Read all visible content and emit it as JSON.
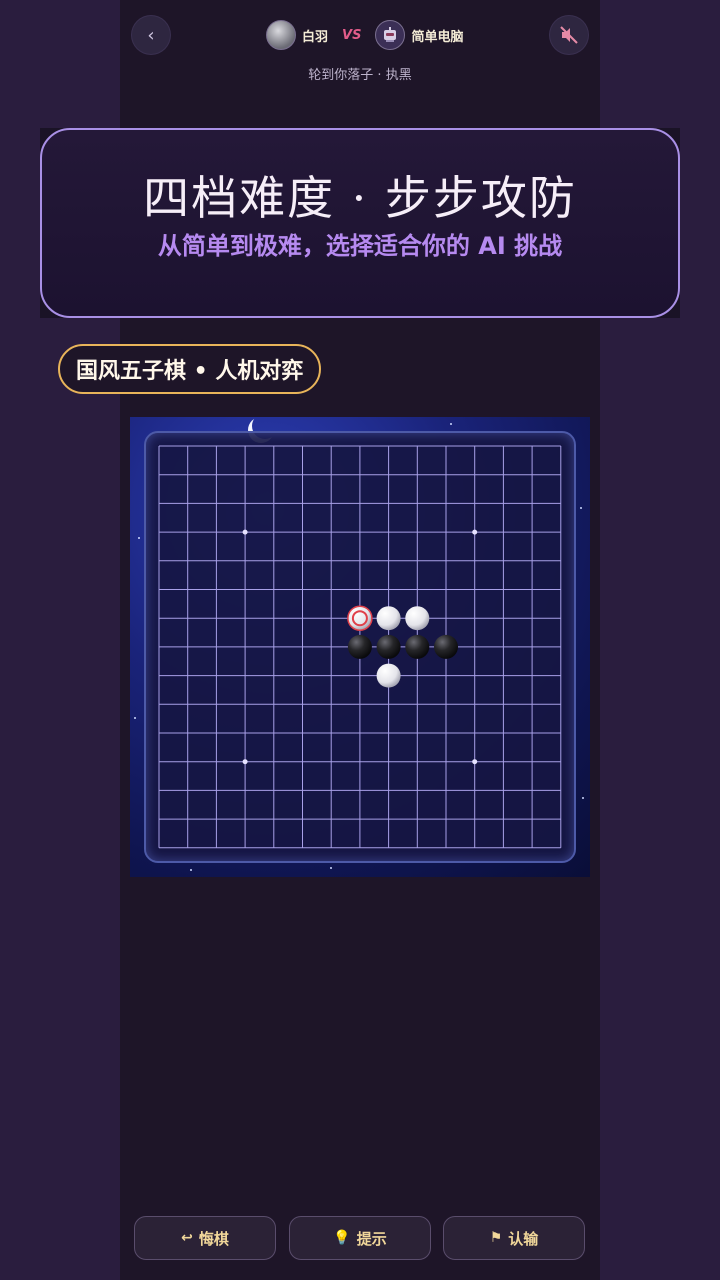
{
  "header": {
    "back_icon": "chevron-left-icon",
    "mute_icon": "speaker-muted-icon",
    "player_name": "白羽",
    "vs_label": "VS",
    "computer_name": "简单电脑",
    "turn_status": "轮到你落子 · 执黑"
  },
  "banner": {
    "title": "四档难度 · 步步攻防",
    "subtitle": "从简单到极难，选择适合你的 AI 挑战"
  },
  "mode_pill": "国风五子棋 • 人机对弈",
  "board": {
    "size": 15,
    "star_points": [
      [
        3,
        3
      ],
      [
        11,
        3
      ],
      [
        3,
        11
      ],
      [
        11,
        11
      ]
    ],
    "stones": [
      {
        "col": 7,
        "row": 6,
        "color": "white",
        "last": true
      },
      {
        "col": 8,
        "row": 6,
        "color": "white"
      },
      {
        "col": 9,
        "row": 6,
        "color": "white"
      },
      {
        "col": 7,
        "row": 7,
        "color": "black"
      },
      {
        "col": 8,
        "row": 7,
        "color": "black"
      },
      {
        "col": 9,
        "row": 7,
        "color": "black"
      },
      {
        "col": 10,
        "row": 7,
        "color": "black"
      },
      {
        "col": 8,
        "row": 8,
        "color": "white"
      }
    ]
  },
  "actions": {
    "undo_label": "悔棋",
    "undo_icon": "undo-arrow-icon",
    "hint_label": "提示",
    "hint_icon": "lightbulb-icon",
    "resign_label": "认输",
    "resign_icon": "flag-icon"
  },
  "colors": {
    "accent_purple": "#a990e6",
    "subtitle_purple": "#b68af0",
    "pill_gold": "#e8b45a",
    "button_text_gold": "#f1d79a",
    "grid_line": "#a8a0e8"
  }
}
